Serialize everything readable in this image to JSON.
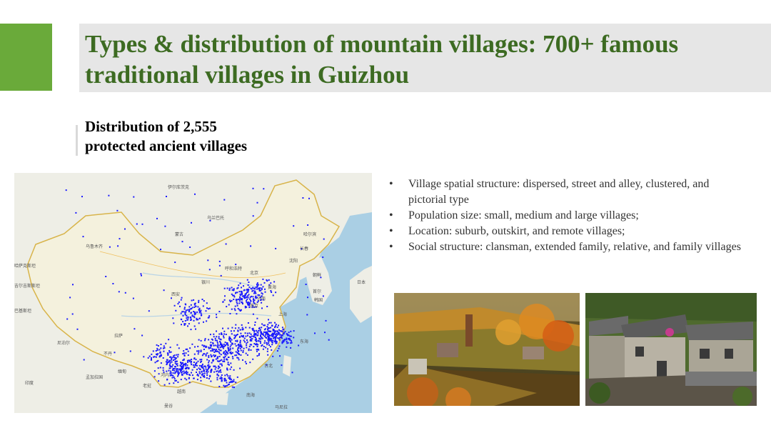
{
  "slide": {
    "title": "Types & distribution of mountain villages: 700+ famous traditional villages in Guizhou",
    "subtitle_line1": "Distribution of 2,555",
    "subtitle_line2": "protected ancient villages",
    "accent_color": "#6aaa3a",
    "title_color": "#3d6b22"
  },
  "bullets": [
    "Village spatial structure: dispersed, street and alley, clustered, and pictorial type",
    "Population size: small, medium and large villages;",
    "Location: suburb, outskirt, and remote villages;",
    "Social structure: clansman, extended family, relative, and family villages"
  ],
  "bullet_glyph": "•",
  "map": {
    "dot_color": "#1a1aff",
    "labels": {
      "mongolia": "蒙古",
      "beijing": "北京",
      "urumqi": "乌鲁木齐",
      "ulaanbaatar": "乌兰巴托",
      "hohhot": "呼和浩特",
      "shenyang": "沈阳",
      "changchun": "长春",
      "harbin": "哈尔滨",
      "xian": "西安",
      "yinchuan": "银川",
      "shanghai": "上海",
      "nanjing": "南京",
      "jinan": "济南",
      "taipei": "台北",
      "hanoi": "河内",
      "lasa": "拉萨",
      "yellowsea": "黄海",
      "eastsea": "东海",
      "southsea": "南海",
      "korea": "朝鲜",
      "hanguo": "韩国",
      "seoul": "首尔",
      "japan": "日本",
      "nepal": "尼泊尔",
      "bhutan": "不丹",
      "myanmar": "缅甸",
      "laos": "老挝",
      "india": "印度",
      "vietnam": "越南",
      "bangladesh": "孟加拉国",
      "kazakhstan": "哈萨克斯坦",
      "kyrgyz": "吉尔吉斯斯坦",
      "pakistan": "巴基斯坦",
      "irkutsk": "伊尔库茨克",
      "manila": "马尼拉",
      "bangkok": "曼谷"
    }
  },
  "photos": {
    "photo1_alt": "autumn village",
    "photo2_alt": "stone houses"
  }
}
